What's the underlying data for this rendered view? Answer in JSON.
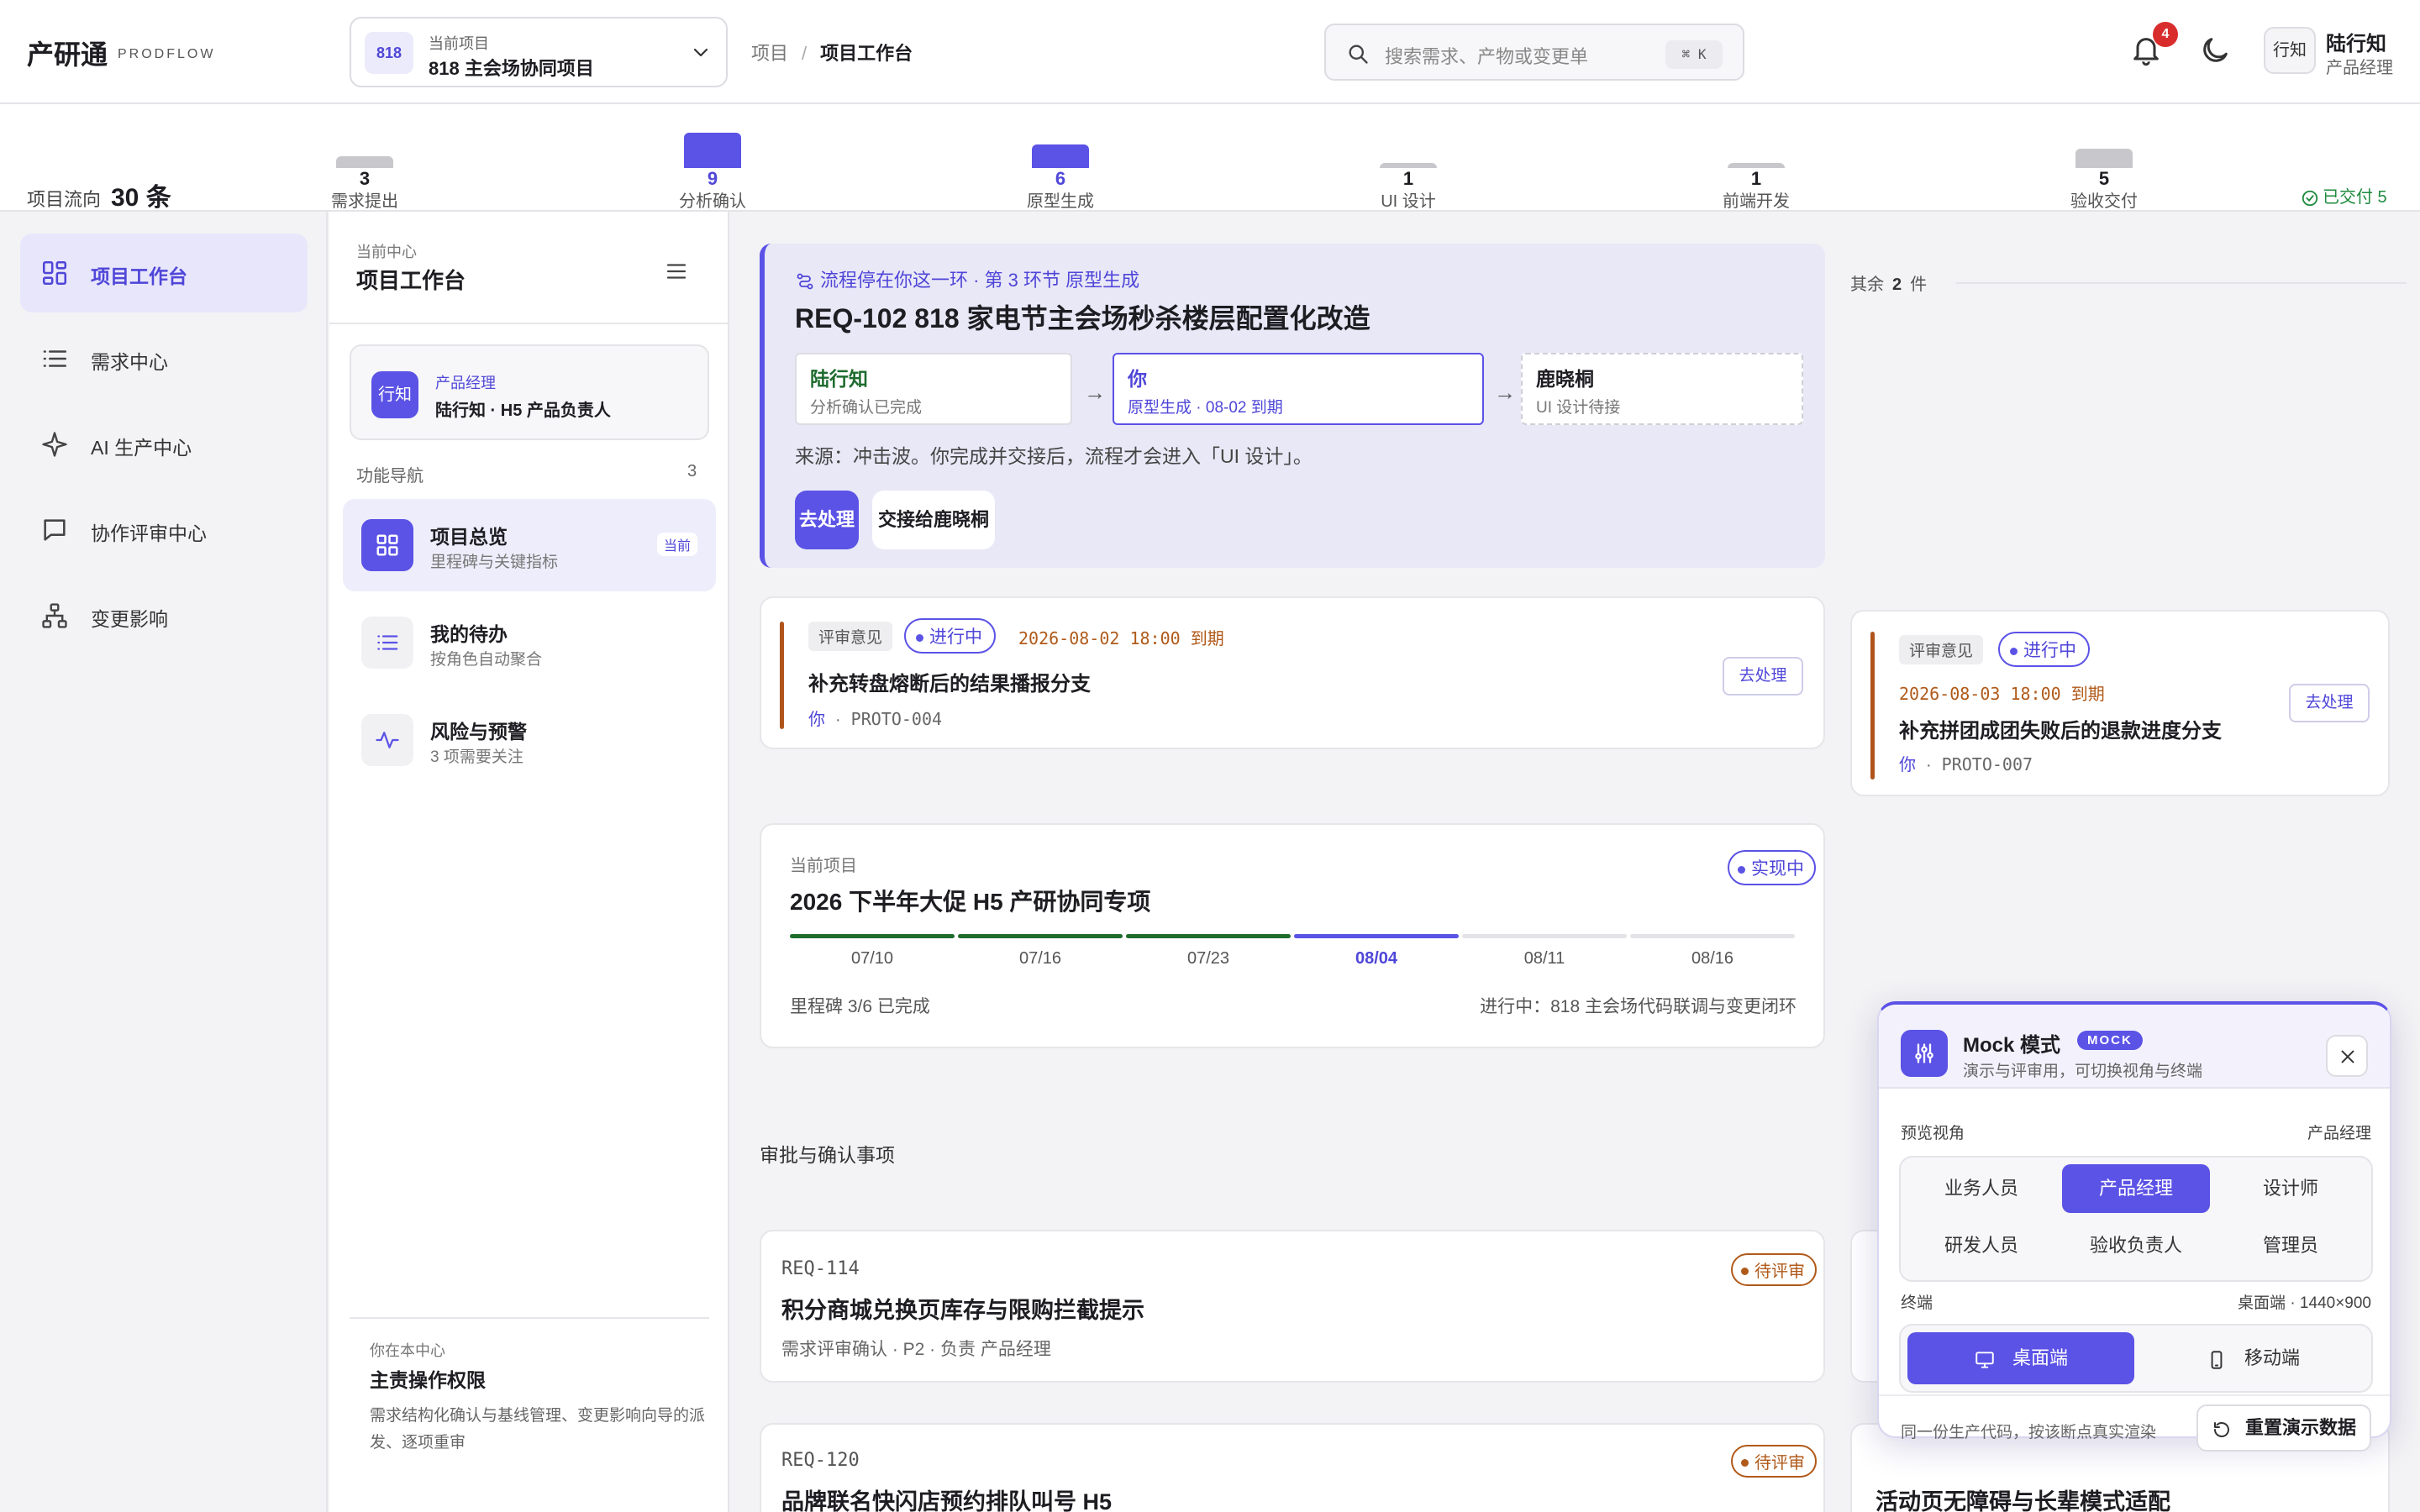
{
  "brand": {
    "name": "产研通",
    "sub": "PRODFLOW"
  },
  "project_select": {
    "badge": "818",
    "label": "当前项目",
    "name": "818 主会场协同项目"
  },
  "breadcrumb": {
    "root": "项目",
    "sep": "/",
    "current": "项目工作台"
  },
  "search": {
    "placeholder": "搜索需求、产物或变更单",
    "shortcut": "⌘ K"
  },
  "notifications": {
    "count": "4"
  },
  "user": {
    "avatar": "行知",
    "name": "陆行知",
    "role": "产品经理"
  },
  "flow": {
    "label": "项目流向",
    "total": "30 条",
    "stages": [
      {
        "count": "3",
        "name": "需求提出",
        "level": 3
      },
      {
        "count": "9",
        "name": "分析确认",
        "level": 9
      },
      {
        "count": "6",
        "name": "原型生成",
        "level": 6
      },
      {
        "count": "1",
        "name": "UI 设计",
        "level": 1
      },
      {
        "count": "1",
        "name": "前端开发",
        "level": 1
      },
      {
        "count": "5",
        "name": "验收交付",
        "level": 5
      }
    ],
    "delivered": "已交付 5"
  },
  "sidebar": {
    "items": [
      {
        "label": "项目工作台",
        "icon": "grid-icon"
      },
      {
        "label": "需求中心",
        "icon": "list-icon"
      },
      {
        "label": "AI 生产中心",
        "icon": "sparkle-icon"
      },
      {
        "label": "协作评审中心",
        "icon": "chat-icon"
      },
      {
        "label": "变更影响",
        "icon": "hierarchy-icon"
      }
    ]
  },
  "panel": {
    "small": "当前中心",
    "title": "项目工作台",
    "role": {
      "avatar": "行知",
      "title": "产品经理",
      "desc": "陆行知 · H5 产品负责人"
    },
    "nav_label": "功能导航",
    "nav_count": "3",
    "items": [
      {
        "title": "项目总览",
        "desc": "里程碑与关键指标",
        "tag": "当前"
      },
      {
        "title": "我的待办",
        "desc": "按角色自动聚合"
      },
      {
        "title": "风险与预警",
        "desc": "3 项需要关注"
      }
    ],
    "footer": {
      "small": "你在本中心",
      "title": "主责操作权限",
      "desc": "需求结构化确认与基线管理、变更影响向导的派发、逐项重审"
    }
  },
  "hero": {
    "top": "流程停在你这一环 · 第 3 环节 原型生成",
    "title": "REQ-102 818 家电节主会场秒杀楼层配置化改造",
    "steps": [
      {
        "name": "陆行知",
        "status": "分析确认已完成"
      },
      {
        "name": "你",
        "status": "原型生成 · 08-02 到期"
      },
      {
        "name": "鹿晓桐",
        "status": "UI 设计待接"
      }
    ],
    "source": "来源：冲击波。你完成并交接后，流程才会进入「UI 设计」。",
    "primary": "去处理",
    "secondary": "交接给鹿晓桐"
  },
  "others": {
    "prefix": "其余",
    "count": "2",
    "suffix": "件"
  },
  "reviews": [
    {
      "tag": "评审意见",
      "status": "进行中",
      "due": "2026-08-02 18:00 到期",
      "title": "补充转盘熔断后的结果播报分支",
      "who": "你",
      "dot": "·",
      "ref": "PROTO-004",
      "action": "去处理"
    },
    {
      "tag": "评审意见",
      "status": "进行中",
      "due": "2026-08-03 18:00 到期",
      "title": "补充拼团成团失败后的退款进度分支",
      "who": "你",
      "dot": "·",
      "ref": "PROTO-007",
      "action": "去处理"
    }
  ],
  "project_card": {
    "small": "当前项目",
    "title": "2026 下半年大促 H5 产研协同专项",
    "status": "实现中",
    "milestones": [
      {
        "date": "07/10",
        "state": "done"
      },
      {
        "date": "07/16",
        "state": "done"
      },
      {
        "date": "07/23",
        "state": "done"
      },
      {
        "date": "08/04",
        "state": "current"
      },
      {
        "date": "08/11",
        "state": "todo"
      },
      {
        "date": "08/16",
        "state": "todo"
      }
    ],
    "progress": "里程碑 3/6 已完成",
    "ongoing": "进行中：818 主会场代码联调与变更闭环"
  },
  "approvals": {
    "title": "审批与确认事项",
    "items": [
      {
        "id": "REQ-114",
        "status": "待评审",
        "title": "积分商城兑换页库存与限购拦截提示",
        "meta": "需求评审确认 · P2 · 负责 产品经理"
      },
      {
        "id": "REQ-120",
        "status": "待评审",
        "title": "品牌联名快闪店预约排队叫号 H5"
      }
    ],
    "side_peek_title": "活动页无障碍与长辈模式适配"
  },
  "mock": {
    "title": "Mock 模式",
    "badge": "MOCK",
    "subtitle": "演示与评审用，可切换视角与终端",
    "view_label": "预览视角",
    "view_value": "产品经理",
    "roles": [
      "业务人员",
      "产品经理",
      "设计师",
      "研发人员",
      "验收负责人",
      "管理员"
    ],
    "selected_role": "产品经理",
    "terminal_label": "终端",
    "terminal_value": "桌面端 · 1440×900",
    "terminals": [
      "桌面端",
      "移动端"
    ],
    "note": "同一份生产代码，按该断点真实渲染",
    "reset": "重置演示数据"
  },
  "colors": {
    "accent": "#5b52e6",
    "done": "#1e6b2e",
    "warn": "#b05a1a",
    "danger": "#d92d2d"
  }
}
